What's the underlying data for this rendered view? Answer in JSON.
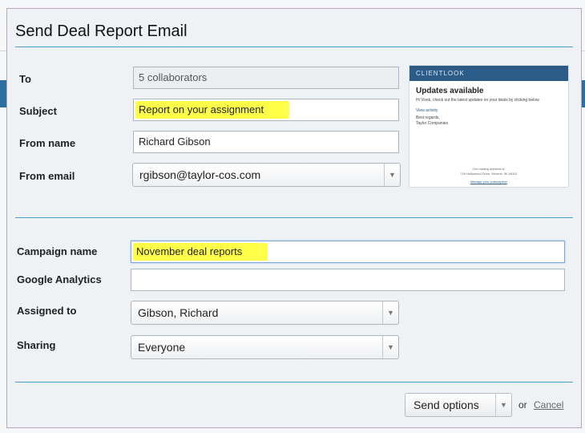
{
  "dialog": {
    "title": "Send Deal Report Email",
    "labels": {
      "to": "To",
      "subject": "Subject",
      "from_name": "From name",
      "from_email": "From email",
      "campaign_name": "Campaign name",
      "google_analytics": "Google Analytics",
      "assigned_to": "Assigned to",
      "sharing": "Sharing"
    },
    "values": {
      "to": "5 collaborators",
      "subject": "Report on your assignment",
      "from_name": "Richard Gibson",
      "from_email": "rgibson@taylor-cos.com",
      "campaign_name": "November deal reports",
      "google_analytics": "",
      "assigned_to": "Gibson, Richard",
      "sharing": "Everyone"
    },
    "highlight_color": "#ffff4a",
    "preview": {
      "brand": "CLIENTLOOK",
      "title": "Updates available",
      "body": "Hi Vivek, check out the latest updates on your deals by clicking below.",
      "link": "View activity",
      "signoff_1": "Best regards,",
      "signoff_2": "Taylor Companies",
      "footer_1": "Our mailing address is:",
      "footer_2": "716 Hollywood Drive, Monroe, MI 48161",
      "unsubscribe": "Manage your subscription",
      "header_color": "#2a5c87"
    },
    "footer": {
      "send_options": "Send options",
      "or": "or",
      "cancel": "Cancel"
    }
  }
}
